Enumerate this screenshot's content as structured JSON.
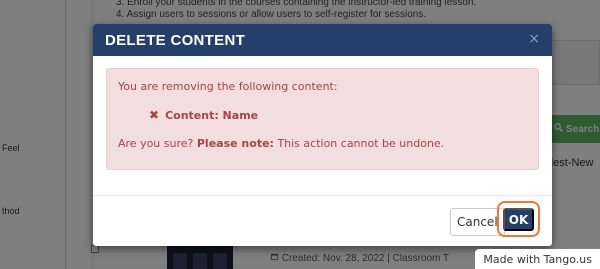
{
  "background": {
    "instructions": [
      "3. Enroll your students in the courses containing the instructor-led training lesson.",
      "4. Assign users to sessions or allow users to self-register for sessions."
    ],
    "left_labels": [
      "Feel",
      "thod"
    ],
    "search_label": "Search",
    "newest_label": "dest-New",
    "created_text": "Created: Nov. 28, 2022 | Classroom T",
    "search_icon": "search-icon",
    "calendar_icon": "calendar-icon",
    "users_icon": "users-icon"
  },
  "modal": {
    "title": "DELETE CONTENT",
    "close_icon": "close-icon",
    "alert": {
      "intro": "You are removing the following content:",
      "item_icon": "x-mark-icon",
      "item_text": "Content: Name",
      "question": "Are you sure?",
      "note_label": "Please note:",
      "note_text": "This action cannot be undone."
    },
    "footer": {
      "cancel_label": "Cancel",
      "ok_label": "OK"
    }
  },
  "colors": {
    "header_bg": "#253f6d",
    "alert_bg": "#f2dede",
    "alert_text": "#a94442",
    "highlight_ring": "#f07833",
    "search_green": "#5cb85c"
  },
  "watermark": "Made with Tango.us"
}
